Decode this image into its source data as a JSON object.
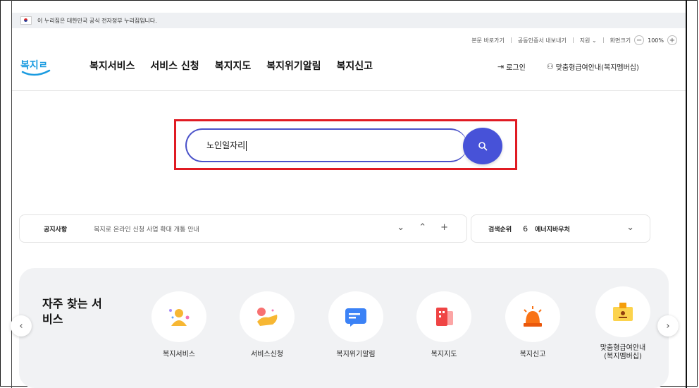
{
  "gov_banner": {
    "text": "이 누리집은 대한민국 공식 전자정부 누리집입니다."
  },
  "utility": {
    "skip_to_content": "본문 바로가기",
    "cert_export": "공동인증서 내보내기",
    "support": "지원",
    "support_chevron": "⌄",
    "zoom_label": "화면크기",
    "zoom_out": "−",
    "zoom_value": "100%",
    "zoom_in": "+"
  },
  "header": {
    "logo_text": "복지로",
    "nav": [
      "복지서비스",
      "서비스 신청",
      "복지지도",
      "복지위기알림",
      "복지신고"
    ],
    "login_label": "로그인",
    "custom_benefit_label": "맞춤형급여안내(복지멤버십)"
  },
  "search": {
    "value": "노인일자리"
  },
  "notice": {
    "label": "공지사항",
    "message": "복지로 온라인 신청 사업 확대 개통 안내",
    "down": "⌄",
    "up": "⌃",
    "add": "+"
  },
  "ranking": {
    "label": "검색순위",
    "number": "6",
    "keyword": "에너지바우처",
    "chevron": "⌄"
  },
  "frequent_services": {
    "title": "자주 찾는 서비스",
    "prev": "‹",
    "next": "›",
    "items": [
      {
        "label": "복지서비스",
        "icon": "people-icon"
      },
      {
        "label": "서비스신청",
        "icon": "hand-icon"
      },
      {
        "label": "복지위기알림",
        "icon": "message-icon"
      },
      {
        "label": "복지지도",
        "icon": "map-icon"
      },
      {
        "label": "복지신고",
        "icon": "siren-icon"
      },
      {
        "label": "맞춤형급여안내\n(복지멤버십)",
        "icon": "membership-icon"
      }
    ]
  },
  "colors": {
    "accent": "#4752d8",
    "highlight": "#e01b23",
    "logo": "#1a9be0"
  }
}
